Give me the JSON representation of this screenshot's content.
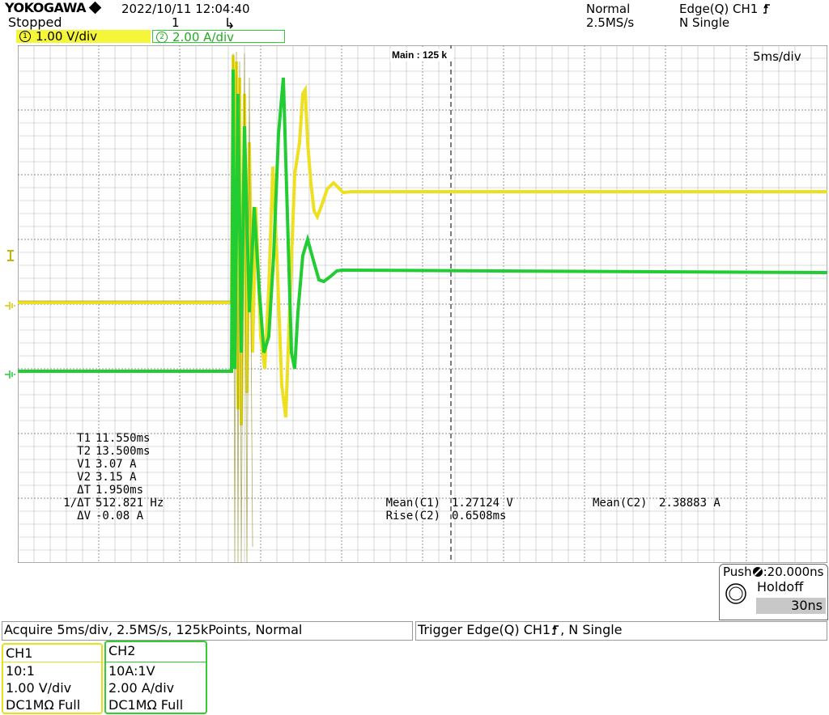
{
  "header": {
    "brand": "YOKOGAWA",
    "datetime": "2022/10/11  12:04:40",
    "status": "Stopped",
    "count": "1",
    "mode": "Normal",
    "sample_rate": "2.5MS/s",
    "trigger": "Edge(Q) CH1",
    "trigger_mode": "N Single"
  },
  "channel_tags": {
    "ch1": {
      "num": "1",
      "text": "1.00 V/div",
      "color": "#f5f53a"
    },
    "ch2": {
      "num": "2",
      "text": "2.00 A/div",
      "color": "#33cc33"
    }
  },
  "scope": {
    "zoom_label": "Main : 125 k",
    "timebase": "5ms/div"
  },
  "cursors": {
    "labels": [
      "T1",
      "T2",
      "V1",
      "V2",
      "ΔT",
      "1/ΔT",
      "ΔV"
    ],
    "values": [
      "11.550ms",
      "13.500ms",
      "3.07 A",
      "3.15 A",
      "1.950ms",
      "512.821 Hz",
      "-0.08 A"
    ]
  },
  "measurements": {
    "m1_label": "Mean(C1)",
    "m1_value": "1.27124 V",
    "m2_label": "Rise(C2)",
    "m2_value": "0.6508ms",
    "m3_label": "Mean(C2)",
    "m3_value": "2.38883 A"
  },
  "holdoff": {
    "push_text": "Push",
    "push_value": ":20.000ns",
    "title": "Holdoff",
    "value": "30ns"
  },
  "acquire": {
    "label": "Acquire",
    "value": "5ms/div, 2.5MS/s, 125kPoints, Normal"
  },
  "trigger_bar": {
    "label": "Trigger",
    "value": "Edge(Q)  CH1",
    "mode": ", N Single"
  },
  "ch1_box": {
    "title": "CH1",
    "probe": "10:1",
    "scale": "1.00  V/div",
    "coupling": "DC1MΩ Full"
  },
  "ch2_box": {
    "title": "CH2",
    "probe": "10A:1V",
    "scale": "2.00  A/div",
    "coupling": "DC1MΩ Full"
  },
  "colors": {
    "ch1": "#f0e020",
    "ch2": "#22cc33",
    "grid": "#9a9a9a"
  }
}
